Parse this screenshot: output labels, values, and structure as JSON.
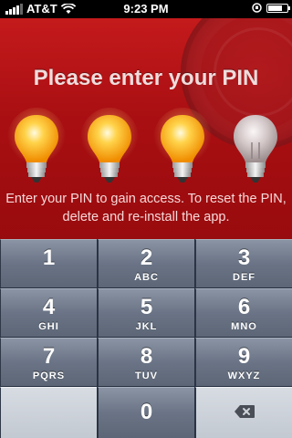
{
  "status_bar": {
    "carrier": "AT&T",
    "time": "9:23 PM"
  },
  "lock_screen": {
    "title": "Please enter your PIN",
    "caption": "Enter your PIN to gain access. To reset the PIN, delete and re-install the app.",
    "pin_slots": [
      {
        "state": "lit"
      },
      {
        "state": "lit"
      },
      {
        "state": "lit"
      },
      {
        "state": "unlit"
      }
    ]
  },
  "keypad": {
    "keys": [
      {
        "num": "1",
        "letters": ""
      },
      {
        "num": "2",
        "letters": "ABC"
      },
      {
        "num": "3",
        "letters": "DEF"
      },
      {
        "num": "4",
        "letters": "GHI"
      },
      {
        "num": "5",
        "letters": "JKL"
      },
      {
        "num": "6",
        "letters": "MNO"
      },
      {
        "num": "7",
        "letters": "PQRS"
      },
      {
        "num": "8",
        "letters": "TUV"
      },
      {
        "num": "9",
        "letters": "WXYZ"
      },
      {
        "num": "0",
        "letters": ""
      }
    ]
  },
  "colors": {
    "panel_red": "#b3141a",
    "key_slate": "#6a7486",
    "bulb_lit": "#ffc21a",
    "bulb_unlit": "#bfb2b4"
  }
}
